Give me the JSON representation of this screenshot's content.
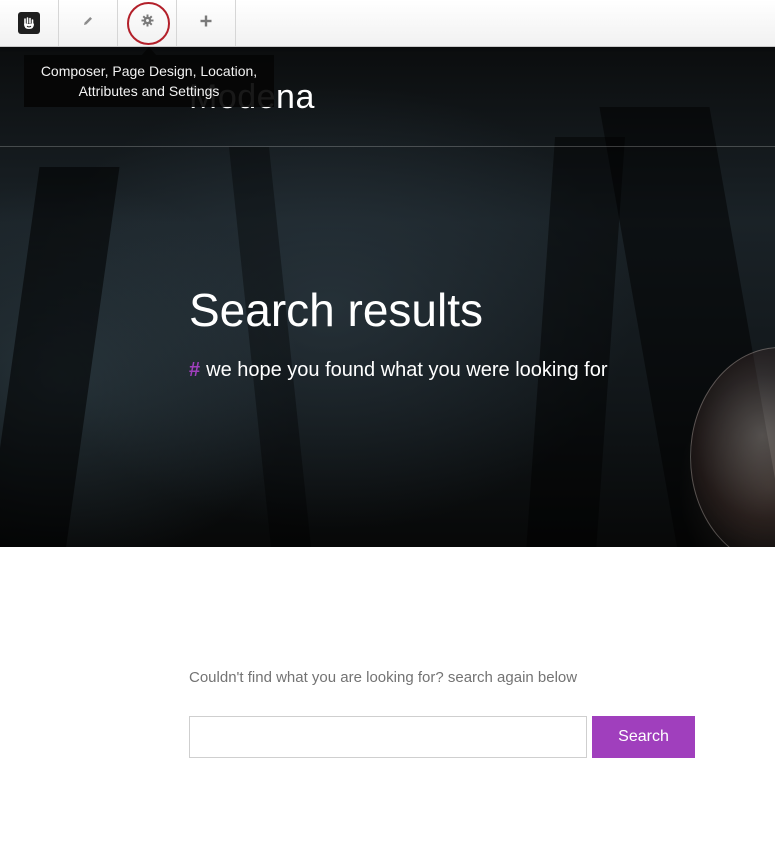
{
  "toolbar": {
    "buttons": [
      {
        "name": "concrete5-logo",
        "icon": "hand-logo-icon"
      },
      {
        "name": "edit-mode",
        "icon": "pencil-icon"
      },
      {
        "name": "page-settings",
        "icon": "gear-icon"
      },
      {
        "name": "add-content",
        "icon": "plus-icon"
      }
    ],
    "tooltip": "Composer, Page Design, Location, Attributes and Settings",
    "highlight_color": "#b3202a"
  },
  "header": {
    "site_name": "Modena"
  },
  "hero": {
    "title": "Search results",
    "hash": "#",
    "subtitle": "we hope you found what you were looking for"
  },
  "search": {
    "message": "Couldn't find what you are looking for? search again below",
    "input_value": "",
    "input_placeholder": "",
    "button_label": "Search"
  },
  "colors": {
    "accent": "#a03fbd",
    "tooltip_bg": "#050505"
  }
}
